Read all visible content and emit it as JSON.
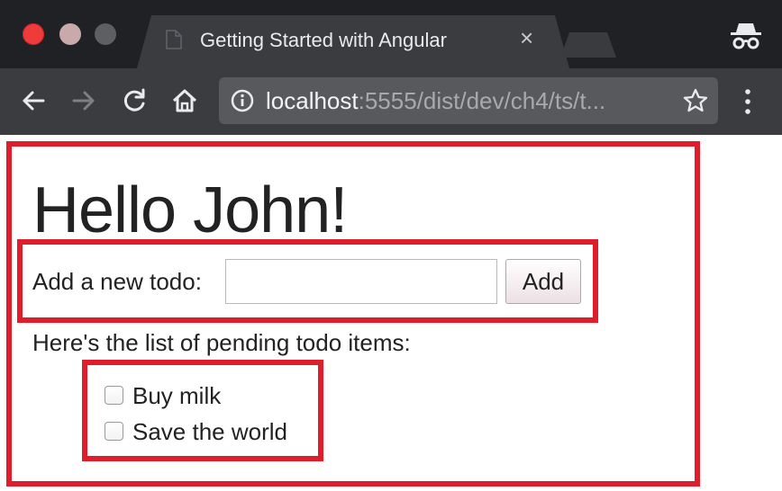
{
  "browser": {
    "tab": {
      "title": "Getting Started with Angular",
      "close_glyph": "×"
    },
    "address_bar": {
      "host": "localhost",
      "rest": ":5555/dist/dev/ch4/ts/t..."
    },
    "icons": {
      "tab": "document-icon",
      "close": "close-icon",
      "incognito": "incognito-icon",
      "back": "back-arrow-icon",
      "forward": "forward-arrow-icon",
      "reload": "reload-icon",
      "home": "home-icon",
      "info": "info-icon",
      "bookmark": "star-icon",
      "menu": "kebab-menu-icon"
    },
    "colors": {
      "titlebar": "#202124",
      "toolbar": "#3b3c3f",
      "omnibox": "#58595d",
      "highlight": "#e01e2b"
    }
  },
  "page": {
    "heading": "Hello John!",
    "form": {
      "label": "Add a new todo:",
      "input_value": "",
      "input_placeholder": "",
      "add_button": "Add"
    },
    "list_label": "Here's the list of pending todo items:",
    "todos": [
      {
        "label": "Buy milk",
        "checked": false
      },
      {
        "label": "Save the world",
        "checked": false
      }
    ]
  }
}
